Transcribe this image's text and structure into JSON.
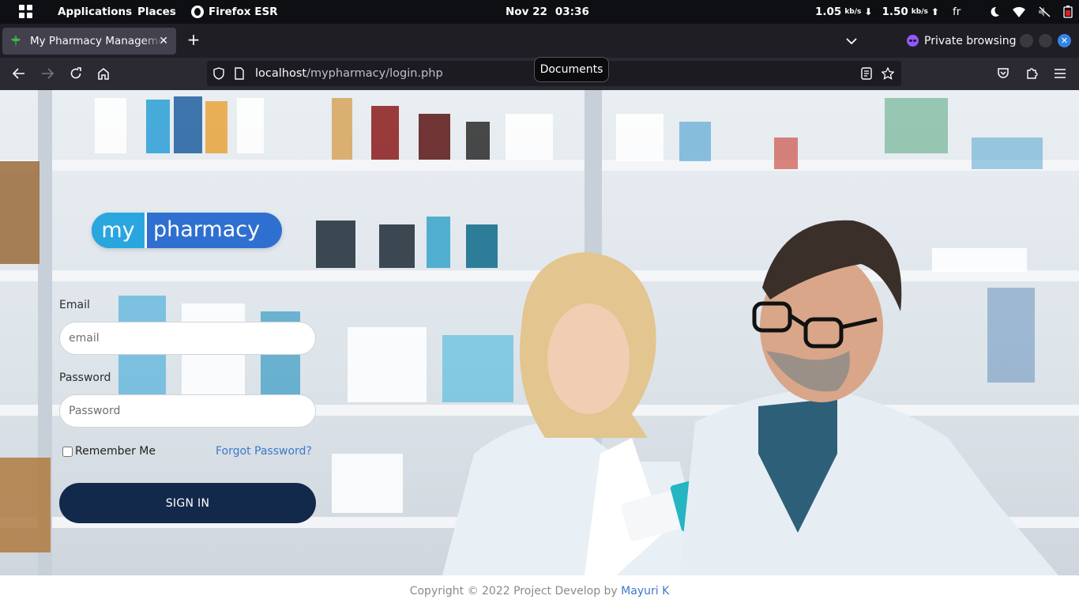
{
  "system_bar": {
    "applications": "Applications",
    "places": "Places",
    "active_app": "Firefox ESR",
    "date": "Nov 22",
    "time": "03:36",
    "net_down_value": "1.05",
    "net_down_unit": "kb/s",
    "net_up_value": "1.50",
    "net_up_unit": "kb/s",
    "keyboard_layout": "fr"
  },
  "browser": {
    "tab_title": "My Pharmacy Management",
    "private_label": "Private browsing",
    "url_host": "localhost",
    "url_path": "/mypharmacy/login.php",
    "tooltip": "Documents",
    "accent_color": "#3584e4",
    "private_color": "#9059ff"
  },
  "page": {
    "logo_part1": "my",
    "logo_part2": "pharmacy",
    "email_label": "Email",
    "email_placeholder": "email",
    "password_label": "Password",
    "password_placeholder": "Password",
    "remember_label": "Remember Me",
    "forgot_link": "Forgot Password?",
    "signin_label": "SIGN IN",
    "footer_text": "Copyright © 2022 Project Develop by",
    "footer_author": "Mayuri K",
    "brand_color": "#13294b",
    "link_color": "#3d78c9"
  }
}
